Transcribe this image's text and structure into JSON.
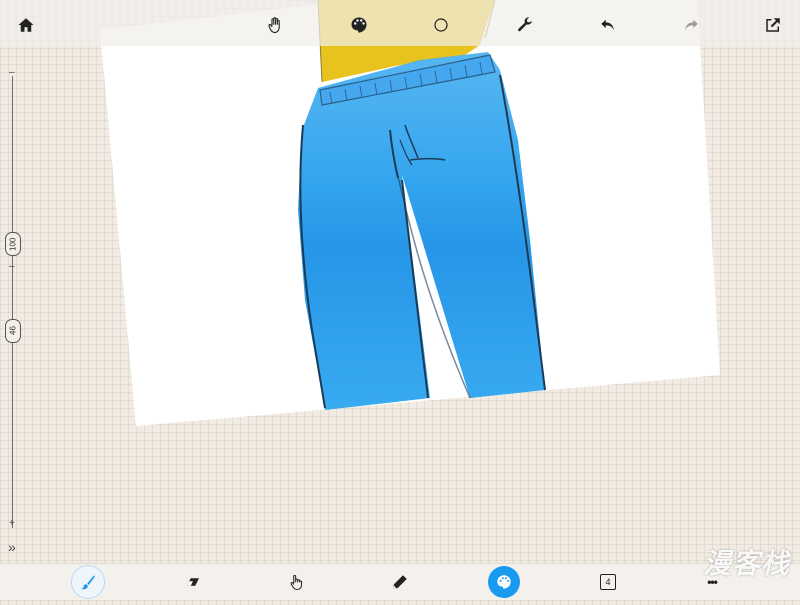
{
  "app": {
    "accent_color": "#1a9aef",
    "background_color": "#f1ebe4"
  },
  "toolbar": {
    "items": [
      {
        "name": "home",
        "icon": "home-icon"
      },
      {
        "name": "pan",
        "icon": "hand-icon"
      },
      {
        "name": "color",
        "icon": "palette-icon"
      },
      {
        "name": "shape",
        "icon": "circle-icon"
      },
      {
        "name": "settings",
        "icon": "wrench-icon"
      },
      {
        "name": "undo",
        "icon": "undo-icon"
      },
      {
        "name": "redo",
        "icon": "redo-icon"
      },
      {
        "name": "share",
        "icon": "share-icon"
      }
    ]
  },
  "left_rail": {
    "brush_size": "100",
    "opacity": "46",
    "minus_symbol": "–",
    "minus_symbol_2": "–",
    "plus_symbol": "+",
    "expand_symbol": "»"
  },
  "bottom_toolbar": {
    "active_tool": "color",
    "layers_count": "4",
    "more_symbol": "•••",
    "items": [
      {
        "name": "brush",
        "icon": "brush-icon"
      },
      {
        "name": "eraser",
        "icon": "eraser-icon"
      },
      {
        "name": "smudge",
        "icon": "finger-icon"
      },
      {
        "name": "pencil",
        "icon": "pencil-icon"
      },
      {
        "name": "color",
        "icon": "palette-icon"
      },
      {
        "name": "layers",
        "icon": "layers-icon"
      },
      {
        "name": "more",
        "icon": "more-icon"
      }
    ]
  },
  "drawing": {
    "jeans_color": "#1e9bec",
    "shirt_color": "#e8c31e",
    "paper_color": "#ffffff"
  },
  "watermark": {
    "text": "漫客栈"
  }
}
